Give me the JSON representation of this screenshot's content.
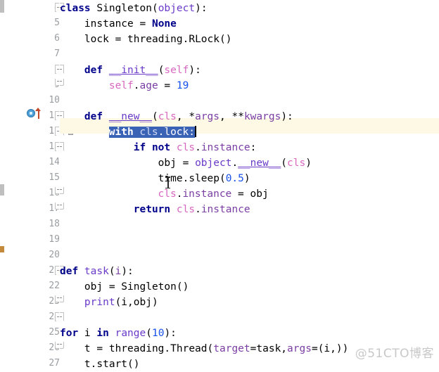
{
  "app": {
    "type": "code-editor",
    "language": "Python",
    "theme": "light"
  },
  "watermark": "@51CTO博客",
  "editor": {
    "first_line": 4,
    "last_line": 27,
    "selected_line": 12,
    "selection_text": "with cls.lock:",
    "colors": {
      "keyword": "#00008b",
      "builtin": "#6a3ac9",
      "self": "#d867c0",
      "attribute": "#7a3ea3",
      "number": "#1750eb",
      "plain": "#000000",
      "selection_bg": "#3a62b5",
      "current_line_bg": "#fdf9e4",
      "line_number": "#999da1",
      "background": "#ffffff"
    }
  },
  "gutter": {
    "icons": [
      {
        "line": 11,
        "name": "override-method-marker",
        "tooltip": "Overrides method in object"
      },
      {
        "line": 12,
        "name": "intention-bulb",
        "tooltip": "Show intention actions"
      }
    ],
    "fold_markers": [
      {
        "line": 4,
        "state": "expanded"
      },
      {
        "line": 8,
        "state": "expanded"
      },
      {
        "line": 9,
        "state": "end"
      },
      {
        "line": 11,
        "state": "expanded"
      },
      {
        "line": 12,
        "state": "expanded"
      },
      {
        "line": 13,
        "state": "expanded"
      },
      {
        "line": 16,
        "state": "end"
      },
      {
        "line": 17,
        "state": "end"
      },
      {
        "line": 21,
        "state": "expanded"
      },
      {
        "line": 23,
        "state": "end"
      },
      {
        "line": 25,
        "state": "expanded"
      },
      {
        "line": 27,
        "state": "end"
      }
    ]
  },
  "lines": [
    {
      "n": 4,
      "text": "class Singleton(object):"
    },
    {
      "n": 5,
      "text": "    instance = None"
    },
    {
      "n": 6,
      "text": "    lock = threading.RLock()"
    },
    {
      "n": 7,
      "text": ""
    },
    {
      "n": 8,
      "text": "    def __init__(self):"
    },
    {
      "n": 9,
      "text": "        self.age = 19"
    },
    {
      "n": 10,
      "text": ""
    },
    {
      "n": 11,
      "text": "    def __new__(cls, *args, **kwargs):"
    },
    {
      "n": 12,
      "text": "        with cls.lock:"
    },
    {
      "n": 13,
      "text": "            if not cls.instance:"
    },
    {
      "n": 14,
      "text": "                obj = object.__new__(cls)"
    },
    {
      "n": 15,
      "text": "                time.sleep(0.5)"
    },
    {
      "n": 16,
      "text": "                cls.instance = obj"
    },
    {
      "n": 17,
      "text": "            return cls.instance"
    },
    {
      "n": 18,
      "text": ""
    },
    {
      "n": 19,
      "text": ""
    },
    {
      "n": 20,
      "text": ""
    },
    {
      "n": 21,
      "text": "def task(i):"
    },
    {
      "n": 22,
      "text": "    obj = Singleton()"
    },
    {
      "n": 23,
      "text": "    print(i,obj)"
    },
    {
      "n": 24,
      "text": ""
    },
    {
      "n": 25,
      "text": "for i in range(10):"
    },
    {
      "n": 26,
      "text": "    t = threading.Thread(target=task,args=(i,))"
    },
    {
      "n": 27,
      "text": "    t.start()"
    }
  ],
  "line_numbers": [
    "4",
    "5",
    "6",
    "7",
    "8",
    "9",
    "10",
    "11",
    "12",
    "13",
    "14",
    "15",
    "16",
    "17",
    "18",
    "19",
    "20",
    "21",
    "22",
    "23",
    "24",
    "25",
    "26",
    "27"
  ],
  "tokens": {
    "l4": [
      [
        "kw",
        "class"
      ],
      [
        "pln",
        " "
      ],
      [
        "cls",
        "Singleton"
      ],
      [
        "pln",
        "("
      ],
      [
        "builtin",
        "object"
      ],
      [
        "pln",
        "):"
      ]
    ],
    "l5": [
      [
        "pln",
        "    instance "
      ],
      [
        "op",
        "= "
      ],
      [
        "kw",
        "None"
      ]
    ],
    "l6": [
      [
        "pln",
        "    lock "
      ],
      [
        "op",
        "= "
      ],
      [
        "pln",
        "threading.RLock()"
      ]
    ],
    "l8": [
      [
        "kw",
        "    def "
      ],
      [
        "fnu",
        "__init__"
      ],
      [
        "pln",
        "("
      ],
      [
        "self",
        "self"
      ],
      [
        "pln",
        "):"
      ]
    ],
    "l9": [
      [
        "pln",
        "        "
      ],
      [
        "self",
        "self"
      ],
      [
        "pln",
        "."
      ],
      [
        "attr",
        "age"
      ],
      [
        "op",
        " = "
      ],
      [
        "num",
        "19"
      ]
    ],
    "l11": [
      [
        "kw",
        "    def "
      ],
      [
        "fnu",
        "__new__"
      ],
      [
        "pln",
        "("
      ],
      [
        "self",
        "cls"
      ],
      [
        "pln",
        ", *"
      ],
      [
        "param",
        "args"
      ],
      [
        "pln",
        ", **"
      ],
      [
        "param",
        "kwargs"
      ],
      [
        "pln",
        "):"
      ]
    ],
    "l12": [
      [
        "kw",
        "with "
      ],
      [
        "self",
        "cls"
      ],
      [
        "attr",
        ".lock"
      ],
      [
        "op",
        ":"
      ]
    ],
    "l13": [
      [
        "kw",
        "            if not "
      ],
      [
        "self",
        "cls"
      ],
      [
        "pln",
        "."
      ],
      [
        "attr",
        "instance"
      ],
      [
        "pln",
        ":"
      ]
    ],
    "l14": [
      [
        "pln",
        "                obj = "
      ],
      [
        "builtin",
        "object"
      ],
      [
        "pln",
        "."
      ],
      [
        "fnu",
        "__new__"
      ],
      [
        "pln",
        "("
      ],
      [
        "self",
        "cls"
      ],
      [
        "pln",
        ")"
      ]
    ],
    "l15": [
      [
        "pln",
        "                time.sleep("
      ],
      [
        "num",
        "0.5"
      ],
      [
        "pln",
        ")"
      ]
    ],
    "l16": [
      [
        "self",
        "cls"
      ],
      [
        "pln",
        "."
      ],
      [
        "attr",
        "instance"
      ],
      [
        "pln",
        " = obj"
      ]
    ],
    "l17": [
      [
        "kw",
        "            return "
      ],
      [
        "self",
        "cls"
      ],
      [
        "pln",
        "."
      ],
      [
        "attr",
        "instance"
      ]
    ],
    "l21": [
      [
        "kw",
        "def "
      ],
      [
        "fn",
        "task"
      ],
      [
        "pln",
        "("
      ],
      [
        "param",
        "i"
      ],
      [
        "pln",
        "):"
      ]
    ],
    "l22": [
      [
        "pln",
        "    obj = Singleton()"
      ]
    ],
    "l23": [
      [
        "fn",
        "    print"
      ],
      [
        "pln",
        "(i,obj)"
      ]
    ],
    "l25": [
      [
        "kw",
        "for "
      ],
      [
        "pln",
        "i "
      ],
      [
        "kw",
        "in "
      ],
      [
        "fn",
        "range"
      ],
      [
        "pln",
        "("
      ],
      [
        "num",
        "10"
      ],
      [
        "pln",
        "):"
      ]
    ],
    "l26": [
      [
        "pln",
        "    t = threading.Thread("
      ],
      [
        "param",
        "target"
      ],
      [
        "op",
        "="
      ],
      [
        "pln",
        "task,"
      ],
      [
        "param",
        "args"
      ],
      [
        "op",
        "="
      ],
      [
        "pln",
        "(i,))"
      ]
    ],
    "l27": [
      [
        "pln",
        "    t.start()"
      ]
    ]
  }
}
